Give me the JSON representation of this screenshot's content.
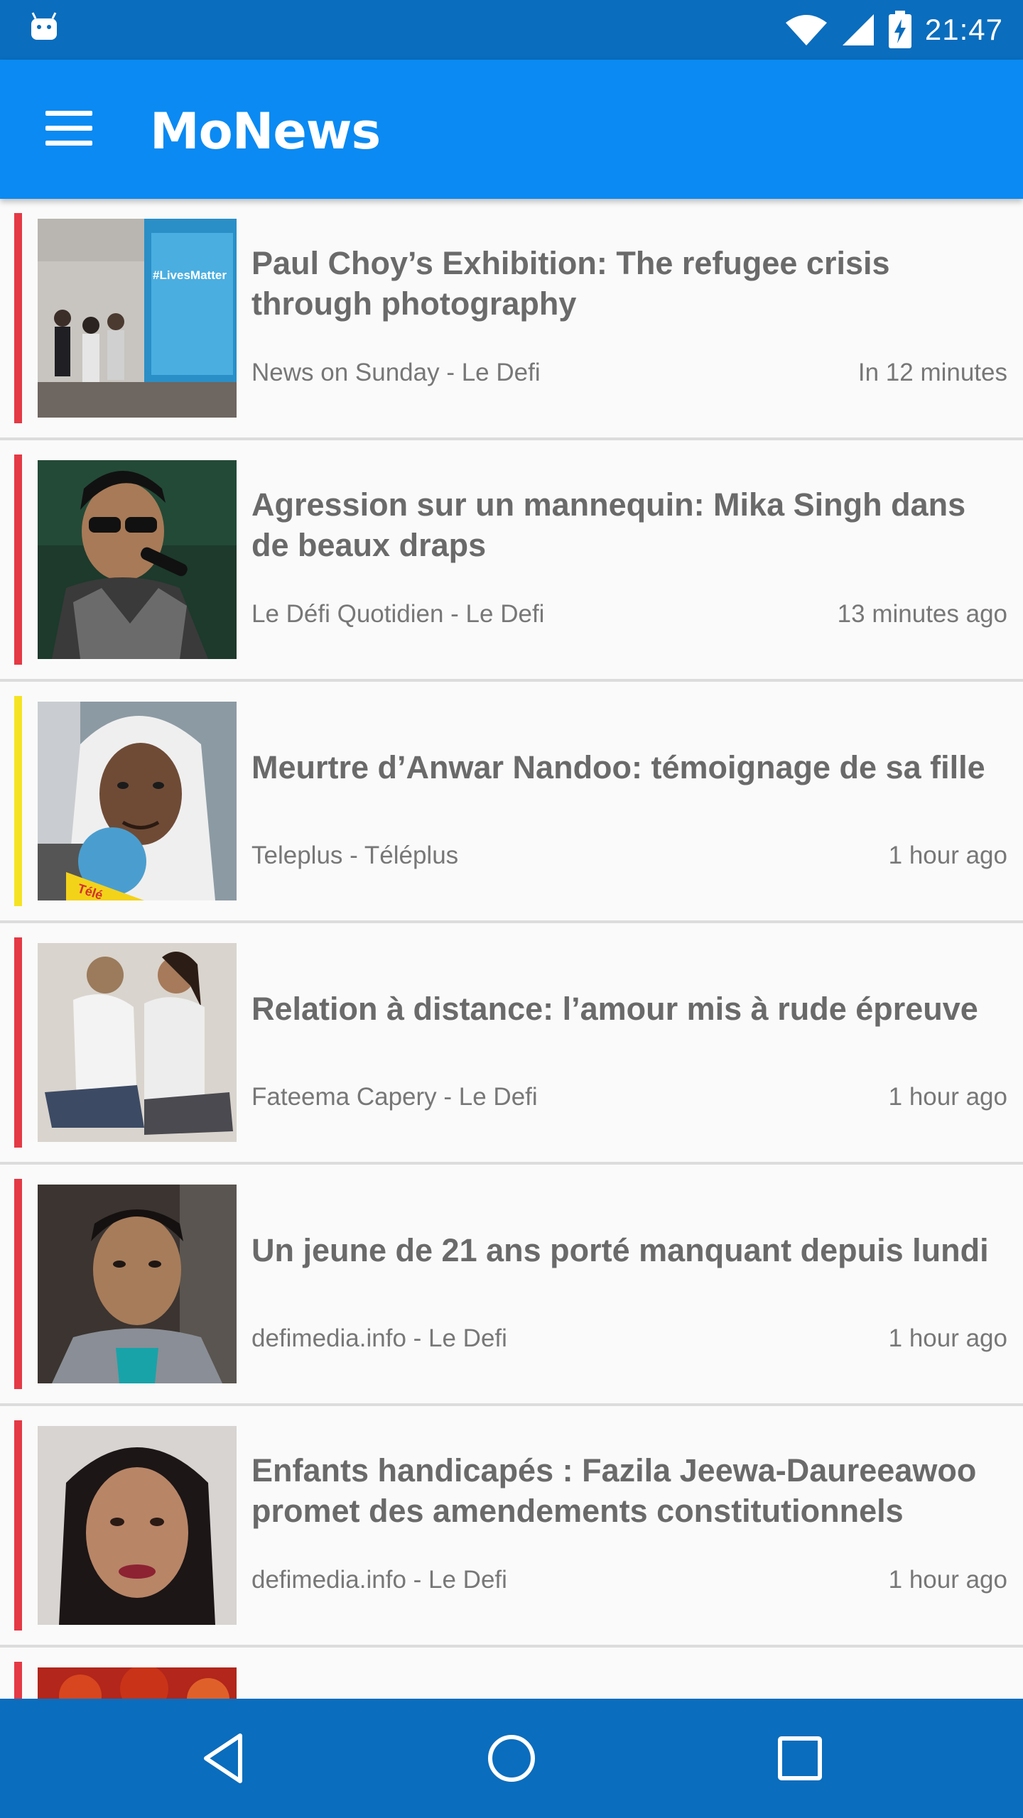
{
  "status_bar": {
    "time": "21:47",
    "icons": [
      "android-icon",
      "wifi-icon",
      "signal-icon",
      "battery-charging-icon"
    ]
  },
  "app_bar": {
    "title": "MoNews",
    "menu_icon": "hamburger-menu-icon",
    "color": "#0a8af2"
  },
  "articles": [
    {
      "headline": "Paul Choy’s Exhibition: The refugee crisis through photography",
      "source": "News on Sunday - Le Defi",
      "time": "In 12 minutes",
      "bar_color": "#e53945",
      "thumb_text": "#LivesMatter"
    },
    {
      "headline": "Agression sur un mannequin: Mika Singh dans de beaux draps",
      "source": "Le Défi Quotidien - Le Defi",
      "time": "13 minutes ago",
      "bar_color": "#e53945"
    },
    {
      "headline": "Meurtre d’Anwar Nandoo: témoignage de sa fille",
      "source": "Teleplus - Téléplus",
      "time": "1 hour ago",
      "bar_color": "#f5e323",
      "thumb_text": "Télé"
    },
    {
      "headline": "Relation à distance: l’amour mis à rude épreuve",
      "source": "Fateema Capery - Le Defi",
      "time": "1 hour ago",
      "bar_color": "#e53945"
    },
    {
      "headline": "Un jeune de 21 ans porté manquant depuis lundi",
      "source": "defimedia.info - Le Defi",
      "time": "1 hour ago",
      "bar_color": "#e53945"
    },
    {
      "headline": "Enfants handicapés : Fazila Jeewa-Daureeawoo promet des amendements constitutionnels",
      "source": "defimedia.info - Le Defi",
      "time": "1 hour ago",
      "bar_color": "#e53945"
    },
    {
      "headline": "",
      "source": "",
      "time": "",
      "bar_color": "#e53945"
    }
  ],
  "nav_bar": {
    "buttons": [
      "back-icon",
      "home-icon",
      "recents-icon"
    ],
    "color": "#0a6dbd"
  }
}
